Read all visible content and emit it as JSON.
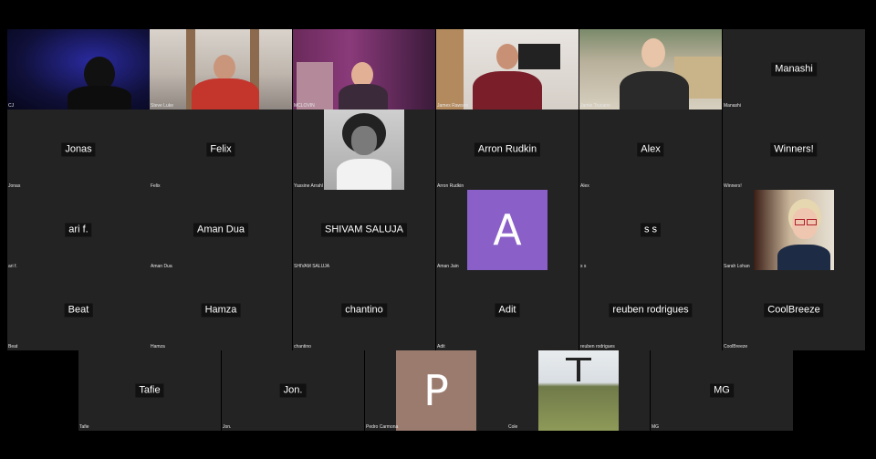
{
  "participants": [
    {
      "label": "CJ",
      "center": "",
      "avatar": "video-dark"
    },
    {
      "label": "Steve Luke",
      "center": "",
      "avatar": "video-red"
    },
    {
      "label": "MCLOVIN",
      "center": "",
      "avatar": "video-purple"
    },
    {
      "label": "James Rawson",
      "center": "",
      "avatar": "video-tv"
    },
    {
      "label": "Jamie Trucano",
      "center": "",
      "avatar": "video-outdoor"
    },
    {
      "label": "Manashi",
      "center": "Manashi",
      "avatar": "none"
    },
    {
      "label": "Jonas",
      "center": "Jonas",
      "avatar": "none"
    },
    {
      "label": "Felix",
      "center": "Felix",
      "avatar": "none"
    },
    {
      "label": "Yassine Arrahl",
      "center": "",
      "avatar": "photo-bw"
    },
    {
      "label": "Arron Rudkin",
      "center": "Arron Rudkin",
      "avatar": "none"
    },
    {
      "label": "Alex",
      "center": "Alex",
      "avatar": "none"
    },
    {
      "label": "Winners!",
      "center": "Winners!",
      "avatar": "none"
    },
    {
      "label": "ari f.",
      "center": "ari f.",
      "avatar": "none"
    },
    {
      "label": "Aman Dua",
      "center": "Aman Dua",
      "avatar": "none"
    },
    {
      "label": "SHIVAM SALUJA",
      "center": "SHIVAM SALUJA",
      "avatar": "none"
    },
    {
      "label": "Aman Jain",
      "center": "",
      "avatar": "letter",
      "letter": "A",
      "color": "#8a5fc8"
    },
    {
      "label": "s s",
      "center": "s s",
      "avatar": "none"
    },
    {
      "label": "Sarah Lohan",
      "center": "",
      "avatar": "photo-woman"
    },
    {
      "label": "Beat",
      "center": "Beat",
      "avatar": "none"
    },
    {
      "label": "Hamza",
      "center": "Hamza",
      "avatar": "none"
    },
    {
      "label": "chantino",
      "center": "chantino",
      "avatar": "none"
    },
    {
      "label": "Adit",
      "center": "Adit",
      "avatar": "none"
    },
    {
      "label": "reuben rodrigues",
      "center": "reuben rodrigues",
      "avatar": "none"
    },
    {
      "label": "CoolBreeze",
      "center": "CoolBreeze",
      "avatar": "none"
    },
    {
      "label": "Tafie",
      "center": "Tafie",
      "avatar": "none"
    },
    {
      "label": "Jon.",
      "center": "Jon.",
      "avatar": "none"
    },
    {
      "label": "Pedro Carmona",
      "center": "",
      "avatar": "letter",
      "letter": "P",
      "color": "#9b7b6e"
    },
    {
      "label": "Cole",
      "center": "",
      "avatar": "photo-field"
    },
    {
      "label": "MG",
      "center": "MG",
      "avatar": "none"
    }
  ]
}
